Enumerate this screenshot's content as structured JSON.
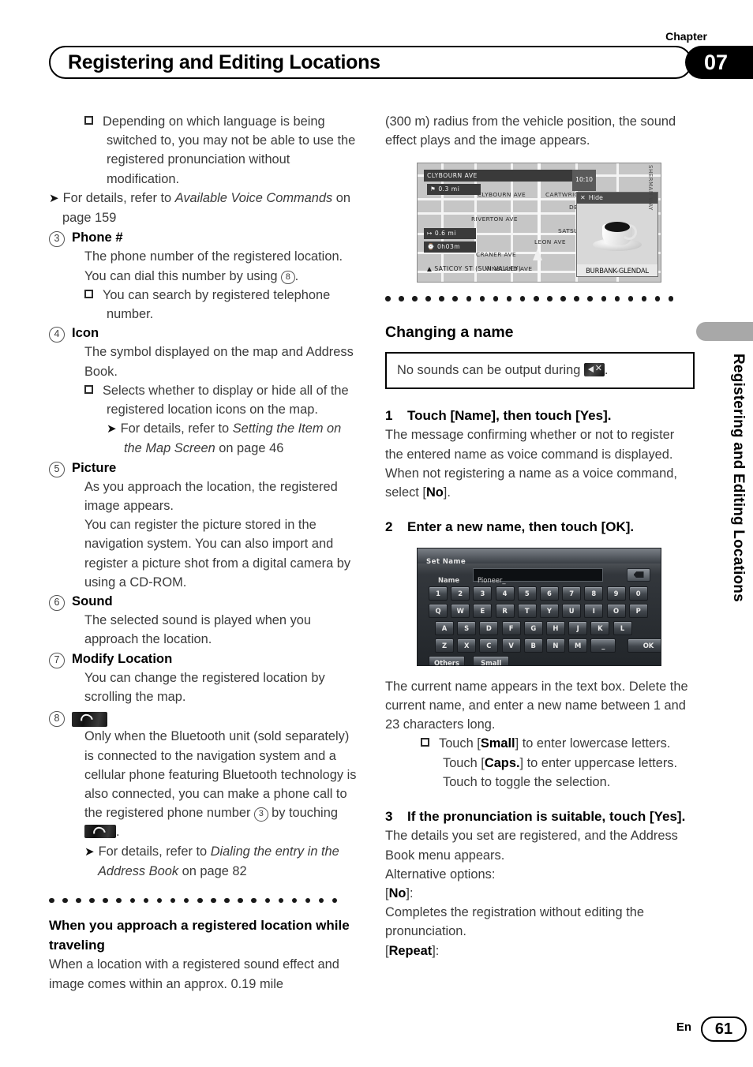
{
  "header": {
    "chapter_label": "Chapter",
    "chapter_number": "07",
    "title": "Registering and Editing Locations"
  },
  "side": {
    "text": "Registering and Editing Locations"
  },
  "footer": {
    "lang": "En",
    "page": "61"
  },
  "left_column": {
    "note_language": "Depending on which language is being switched to, you may not be able to use the registered pronunciation without modification.",
    "ref_voice_commands_pre": "For details, refer to ",
    "ref_voice_commands_it": "Available Voice Commands",
    "ref_voice_commands_post": " on page 159",
    "items": [
      {
        "num": "3",
        "name": "Phone #",
        "body_pre": "The phone number of the registered location. You can dial this number by using ",
        "body_ref": "8",
        "body_post": ".",
        "note": "You can search by registered telephone number."
      },
      {
        "num": "4",
        "name": "Icon",
        "body": "The symbol displayed on the map and Address Book.",
        "note": "Selects whether to display or hide all of the registered location icons on the map.",
        "ref_pre": "For details, refer to ",
        "ref_it": "Setting the Item on the Map Screen",
        "ref_post": " on page 46"
      },
      {
        "num": "5",
        "name": "Picture",
        "body1": "As you approach the location, the registered image appears.",
        "body2": "You can register the picture stored in the navigation system. You can also import and register a picture shot from a digital camera by using a CD-ROM."
      },
      {
        "num": "6",
        "name": "Sound",
        "body": "The selected sound is played when you approach the location."
      },
      {
        "num": "7",
        "name": "Modify Location",
        "body": "You can change the registered location by scrolling the map."
      },
      {
        "num": "8",
        "name_icon": "phone-button-icon",
        "body_pre": "Only when the Bluetooth unit (sold separately) is connected to the navigation system and a cellular phone featuring Bluetooth technology is also connected, you can make a phone call to the registered phone number ",
        "body_ref": "3",
        "body_mid": " by touching ",
        "body_post": ".",
        "ref_pre": "For details, refer to ",
        "ref_it": "Dialing the entry in the Address Book",
        "ref_post": " on page 82"
      }
    ],
    "subhead_approach": "When you approach a registered location while traveling",
    "approach_body": "When a location with a registered sound effect and image comes within an approx. 0.19 mile"
  },
  "right_column": {
    "continuation": "(300 m) radius from the vehicle position, the sound effect plays and the image appears.",
    "map_screenshot": {
      "name": "navigation-map-screenshot",
      "street_label_top": "CLYBOURN AVE",
      "distance_badge": "0.3 mi",
      "clock": "10:10",
      "roads": [
        "CLYBOURN AVE",
        "CARTWRIGHT AVE",
        "DENNY AVE",
        "RIVERTON AVE",
        "SATSUMA",
        "LEON AVE",
        "CRANER AVE",
        "VINELAND AVE",
        "SHERMAN WAY"
      ],
      "remaining_distance": "0.6 mi",
      "remaining_time": "0h03m",
      "current_street": "SATICOY ST (SUN VALLEY)",
      "panel_hide_label": "Hide",
      "panel_caption": "BURBANK-GLENDAL"
    },
    "section_title": "Changing a name",
    "note_box_pre": "No sounds can be output during ",
    "note_box_icon": "mute-icon",
    "note_box_post": ".",
    "steps": [
      {
        "num": "1",
        "heading": "Touch [Name], then touch [Yes].",
        "body1": "The message confirming whether or not to register the entered name as voice command is displayed.",
        "body2_pre": "When not registering a name as a voice command, select [",
        "body2_bold": "No",
        "body2_post": "]."
      },
      {
        "num": "2",
        "heading": "Enter a new name, then touch [OK].",
        "body1": "The current name appears in the text box. Delete the current name, and enter a new name between 1 and 23 characters long.",
        "note_a_pre": "Touch [",
        "note_a_bold": "Small",
        "note_a_post": "] to enter lowercase letters.",
        "note_b_pre": "Touch [",
        "note_b_bold": "Caps.",
        "note_b_post": "] to enter uppercase letters.",
        "note_c": "Touch to toggle the selection."
      },
      {
        "num": "3",
        "heading": "If the pronunciation is suitable, touch [Yes].",
        "body1": "The details you set are registered, and the Address Book menu appears.",
        "body2": "Alternative options:",
        "opt1_pre": "[",
        "opt1_bold": "No",
        "opt1_post": "]:",
        "opt1_body": "Completes the registration without editing the pronunciation.",
        "opt2_pre": "[",
        "opt2_bold": "Repeat",
        "opt2_post": "]:"
      }
    ],
    "keyboard_screenshot": {
      "name": "set-name-keyboard-screenshot",
      "title": "Set Name",
      "field_label": "Name",
      "field_value": "Pioneer_",
      "row1": [
        "1",
        "2",
        "3",
        "4",
        "5",
        "6",
        "7",
        "8",
        "9",
        "0"
      ],
      "row2": [
        "Q",
        "W",
        "E",
        "R",
        "T",
        "Y",
        "U",
        "I",
        "O",
        "P"
      ],
      "row3": [
        "A",
        "S",
        "D",
        "F",
        "G",
        "H",
        "J",
        "K",
        "L"
      ],
      "row4": [
        "Z",
        "X",
        "C",
        "V",
        "B",
        "N",
        "M",
        "_"
      ],
      "ok_key": "OK",
      "others_key": "Others",
      "small_key": "Small",
      "delete_key": "delete-icon"
    }
  }
}
